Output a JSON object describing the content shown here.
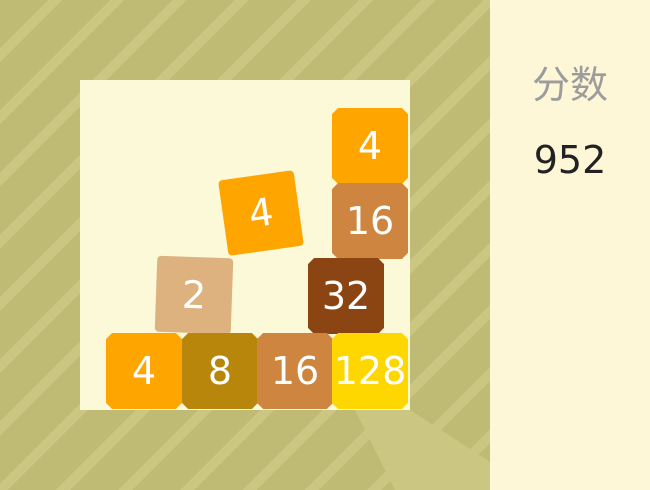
{
  "score": {
    "label": "分数",
    "value": "952"
  },
  "colors": {
    "background": "#bfbb74",
    "stripe": "#cbc783",
    "board": "#fbf9d8",
    "panel": "#fdf6d7",
    "tile_2": "#ddb27f",
    "tile_4": "#fea500",
    "tile_8": "#b8860b",
    "tile_16": "#cd853f",
    "tile_32": "#8b4513",
    "tile_128": "#ffd700"
  },
  "tiles": [
    {
      "value": "4",
      "color": "#fea500"
    },
    {
      "value": "16",
      "color": "#cd853f"
    },
    {
      "value": "4",
      "color": "#fea500"
    },
    {
      "value": "32",
      "color": "#8b4513"
    },
    {
      "value": "2",
      "color": "#ddb27f"
    },
    {
      "value": "4",
      "color": "#fea500"
    },
    {
      "value": "8",
      "color": "#b8860b"
    },
    {
      "value": "16",
      "color": "#cd853f"
    },
    {
      "value": "128",
      "color": "#ffd700"
    }
  ]
}
